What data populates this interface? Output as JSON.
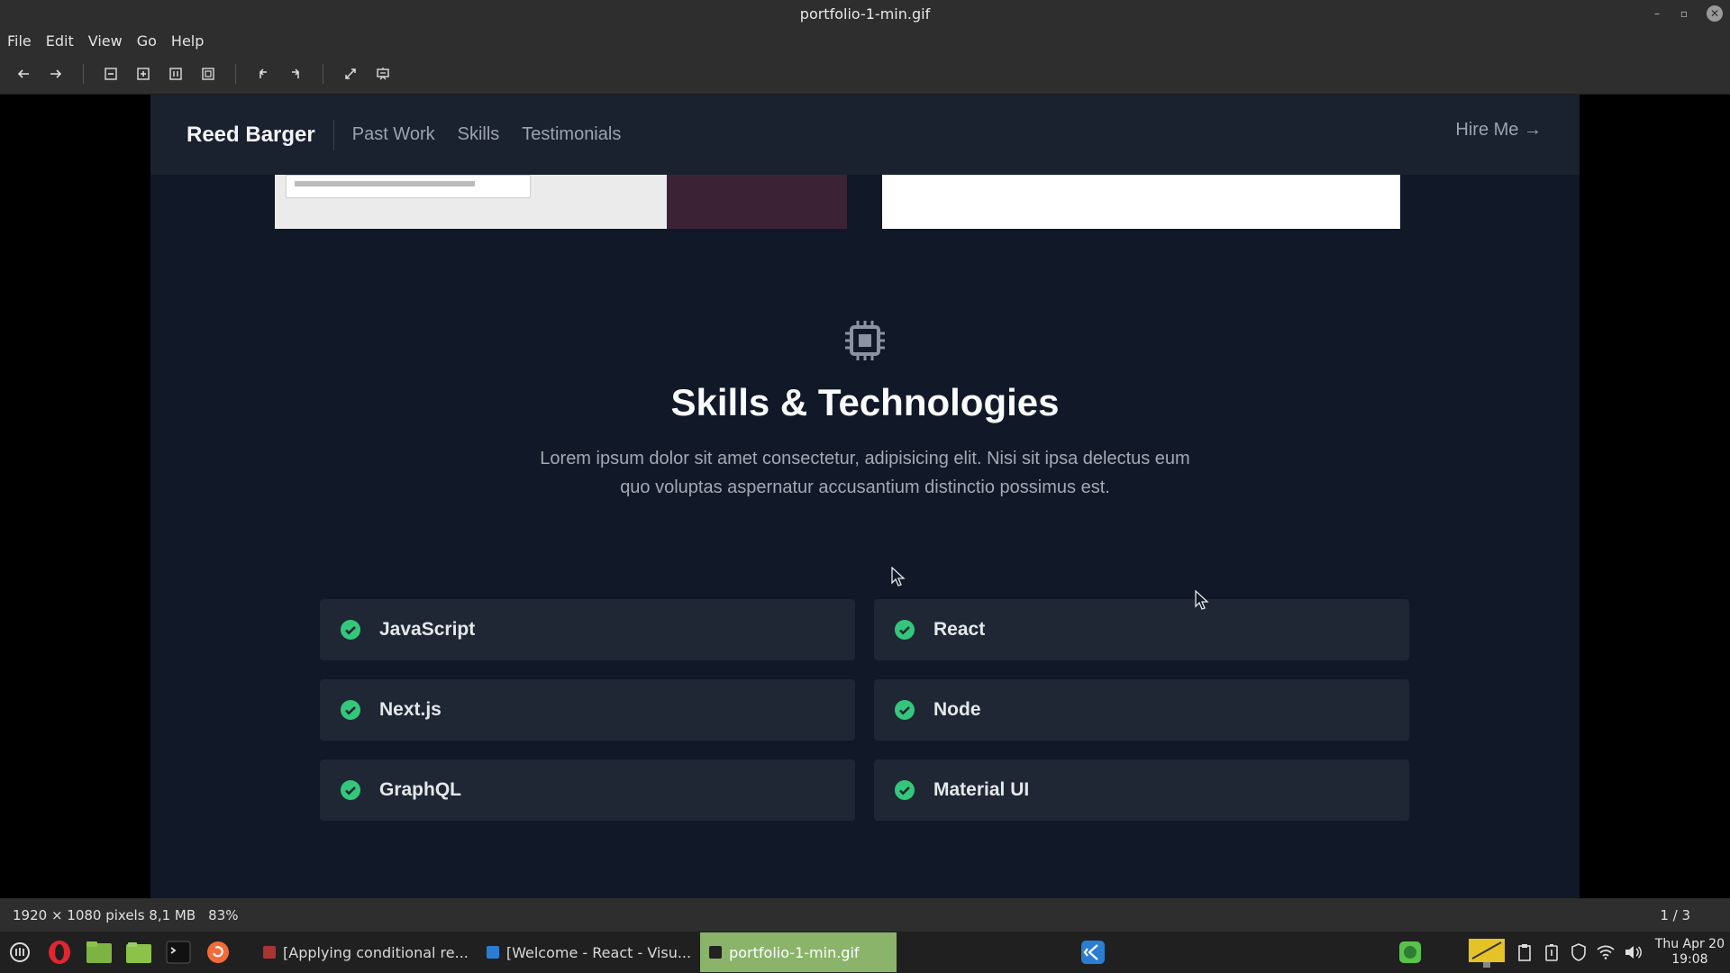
{
  "window": {
    "title": "portfolio-1-min.gif"
  },
  "menu": [
    "File",
    "Edit",
    "View",
    "Go",
    "Help"
  ],
  "site": {
    "brand": "Reed Barger",
    "nav_links": [
      "Past Work",
      "Skills",
      "Testimonials"
    ],
    "cta": "Hire Me →"
  },
  "skills": {
    "title": "Skills & Technologies",
    "description_line1": "Lorem ipsum dolor sit amet consectetur, adipisicing elit. Nisi sit ipsa delectus eum",
    "description_line2": "quo voluptas aspernatur accusantium distinctio possimus est.",
    "items": [
      "JavaScript",
      "React",
      "Next.js",
      "Node",
      "GraphQL",
      "Material UI"
    ]
  },
  "status": {
    "info": "1920 × 1080 pixels  8,1 MB",
    "zoom": "83%",
    "page": "1 / 3"
  },
  "taskbar": {
    "windows": [
      "[Applying conditional re...",
      "[Welcome - React - Visu...",
      "portfolio-1-min.gif"
    ],
    "clock_day": "Thu Apr 20",
    "clock_time": "19:08"
  },
  "colors": {
    "check_green": "#34c77b",
    "active_task": "#8ab46a"
  }
}
